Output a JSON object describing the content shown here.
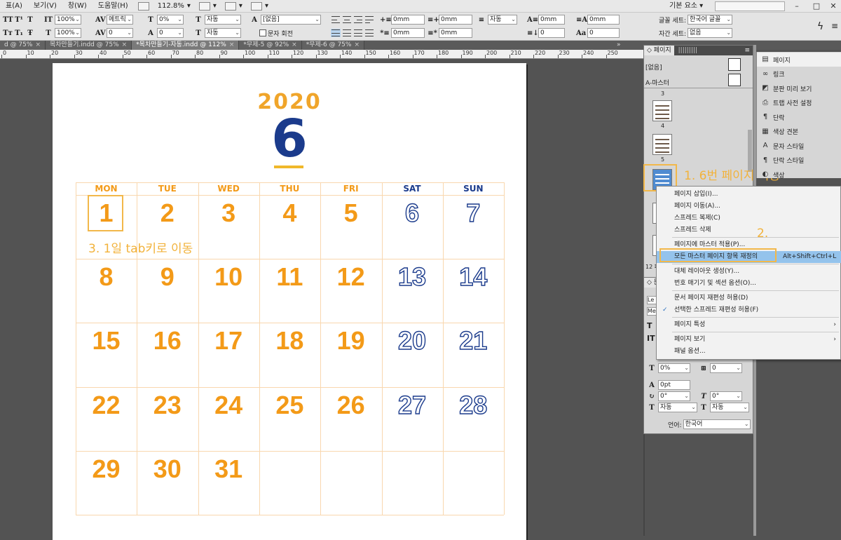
{
  "menu": {
    "items": [
      "표(A)",
      "보기(V)",
      "창(W)",
      "도움말(H)"
    ],
    "zoom": "112.8%",
    "workspace": "기본 요소"
  },
  "tabs": [
    {
      "label": "d @ 75%"
    },
    {
      "label": "목차만들기.indd @ 75%"
    },
    {
      "label": "*목차만들기-자동.indd @ 112%"
    },
    {
      "label": "*무제-5 @ 92%"
    },
    {
      "label": "*무제-6 @ 75%"
    }
  ],
  "control": {
    "scale_h": "100%",
    "scale_v": "100%",
    "kerning": "메트릭",
    "tracking": "0",
    "skew": "0%",
    "baseline": "0",
    "lang_a": "자동",
    "lang_b": "자동",
    "char_style": "[없음]",
    "char_rotate_label": "문자 회전",
    "indent_left": "0mm",
    "indent_first": "0mm",
    "indent_right": "0mm",
    "indent_last": "0mm",
    "space_before": "0mm",
    "space_after": "0mm",
    "auto": "자동",
    "num_a": "0",
    "num_b": "0",
    "dropcap_a": "0mm",
    "dropcap_b": "0mm",
    "font_set_label": "글꼴 세트:",
    "font_set": "한국어 글꼴",
    "spacing_set_label": "자간 세트:",
    "spacing_set": "없음"
  },
  "ruler": [
    "0",
    "10",
    "20",
    "30",
    "40",
    "50",
    "60",
    "70",
    "80",
    "90",
    "100",
    "110",
    "120",
    "130",
    "140",
    "150",
    "160",
    "170",
    "180",
    "190",
    "200",
    "210",
    "220",
    "230",
    "240",
    "250"
  ],
  "calendar": {
    "year": "2020",
    "month": "6",
    "days": [
      "MON",
      "TUE",
      "WED",
      "THU",
      "FRI",
      "SAT",
      "SUN"
    ],
    "weeks": [
      [
        "1",
        "2",
        "3",
        "4",
        "5",
        "6",
        "7"
      ],
      [
        "8",
        "9",
        "10",
        "11",
        "12",
        "13",
        "14"
      ],
      [
        "15",
        "16",
        "17",
        "18",
        "19",
        "20",
        "21"
      ],
      [
        "22",
        "23",
        "24",
        "25",
        "26",
        "27",
        "28"
      ],
      [
        "29",
        "30",
        "31",
        "",
        "",
        "",
        ""
      ]
    ]
  },
  "annotations": {
    "a1": "1. 6번 페이지 이동",
    "a2": "2.",
    "a3": "3. 1일 tab키로 이동"
  },
  "pages_panel": {
    "tab": "페이지",
    "none": "[없음]",
    "master": "A-마스터",
    "page_nums": [
      "3",
      "4",
      "5"
    ],
    "footer": "12 페",
    "lower_lang_label": "언어:",
    "lower_lang": "한국어",
    "lower_fields": [
      "0%",
      "0",
      "0pt",
      "0°",
      "0°",
      "자동",
      "자동"
    ],
    "lower_stub": [
      "Le",
      "Me"
    ]
  },
  "right_panel": [
    {
      "icon": "pages-icon",
      "label": "페이지"
    },
    {
      "icon": "link-icon",
      "label": "링크"
    },
    {
      "icon": "separation-icon",
      "label": "분판 미리 보기"
    },
    {
      "icon": "trap-icon",
      "label": "트랩 사전 설정"
    },
    {
      "icon": "paragraph-icon",
      "label": "단락"
    },
    {
      "icon": "swatches-icon",
      "label": "색상 견본"
    },
    {
      "icon": "char-style-icon",
      "label": "문자 스타일"
    },
    {
      "icon": "para-style-icon",
      "label": "단락 스타일"
    },
    {
      "icon": "color-icon",
      "label": "색상"
    }
  ],
  "context_menu": [
    {
      "label": "페이지 삽입(I)..."
    },
    {
      "label": "페이지 이동(A)..."
    },
    {
      "label": "스프레드 복제(C)"
    },
    {
      "label": "스프레드 삭제"
    },
    {
      "label": "페이지에 마스터 적용(P)..."
    },
    {
      "label": "모든 마스터 페이지 항목 재정의",
      "shortcut": "Alt+Shift+Ctrl+L"
    },
    {
      "label": "대체 레이아웃 생성(Y)..."
    },
    {
      "label": "번호 매기기 및 섹션 옵션(O)..."
    },
    {
      "label": "문서 페이지 재편성 허용(D)"
    },
    {
      "label": "선택한 스프레드 재편성 허용(F)"
    },
    {
      "label": "페이지 특성"
    },
    {
      "label": "페이지 보기"
    },
    {
      "label": "패널 옵션..."
    }
  ],
  "colors": {
    "orange": "#f39a18",
    "navy": "#1b3b8c",
    "annot": "#f2b23a",
    "highlight": "#94c3ec"
  }
}
